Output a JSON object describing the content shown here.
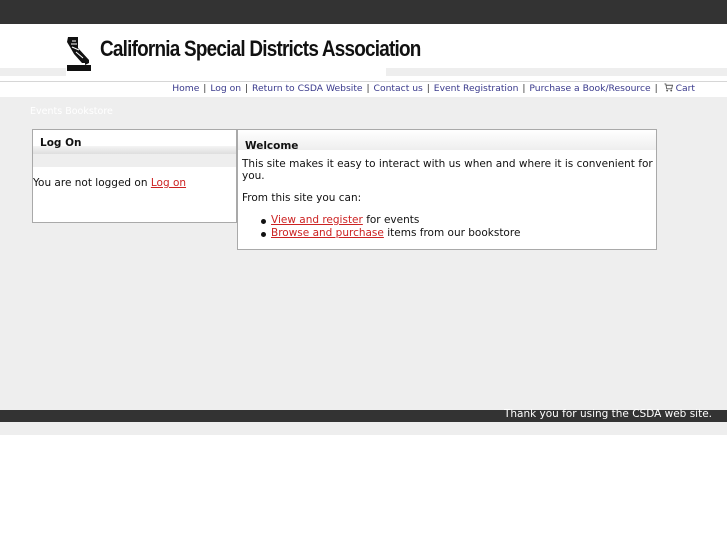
{
  "header": {
    "org_name": "California Special Districts Association",
    "logo_badge": "CSDA"
  },
  "nav": {
    "items": [
      {
        "label": "Home"
      },
      {
        "label": "Log on"
      },
      {
        "label": "Return to CSDA Website"
      },
      {
        "label": "Contact us"
      },
      {
        "label": "Event Registration"
      },
      {
        "label": "Purchase a Book/Resource"
      }
    ],
    "cart_label": "Cart",
    "separator": "|"
  },
  "subnav": {
    "events": "Events",
    "bookstore": "Bookstore"
  },
  "logon_panel": {
    "title": "Log On",
    "status_text": "You are not logged on",
    "link": "Log on"
  },
  "welcome_panel": {
    "title": "Welcome",
    "intro": "This site makes it easy to interact with us when and where it is convenient for you.",
    "lead": "From this site you can:",
    "items": [
      {
        "link": "View and register",
        "text": "for events"
      },
      {
        "link": "Browse and purchase",
        "text": "items from our bookstore"
      }
    ]
  },
  "footer": {
    "text": "Thank you for using the CSDA web site."
  },
  "colors": {
    "topbar": "#333333",
    "content_bg": "#eeeeee",
    "nav_link": "#3a3a8c",
    "red_link": "#cc2222"
  }
}
